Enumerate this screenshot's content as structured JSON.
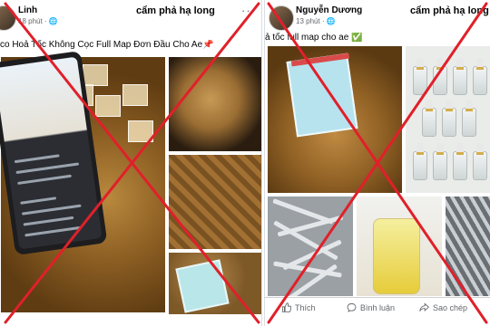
{
  "left_post": {
    "author": "Linh",
    "time": "18 phút",
    "group": "cẩm phả hạ long",
    "more": "···",
    "caption": "co Hoả Tốc Không Cọc Full Map Đơn Đầu Cho Ae",
    "caption_emoji": "📌"
  },
  "right_post": {
    "author": "Nguyễn Dương",
    "time": "13 phút",
    "group": "cẩm phả hạ long",
    "caption": "ả tốc full map cho ae",
    "caption_emoji": "✅",
    "actions": {
      "like": "Thích",
      "comment": "Bình luận",
      "copy": "Sao chép"
    }
  },
  "colors": {
    "cross": "#e0202a",
    "text_primary": "#050505",
    "text_secondary": "#65676b"
  },
  "icons": [
    "globe-icon",
    "thumb-up-icon",
    "comment-icon",
    "share-icon",
    "more-icon"
  ]
}
